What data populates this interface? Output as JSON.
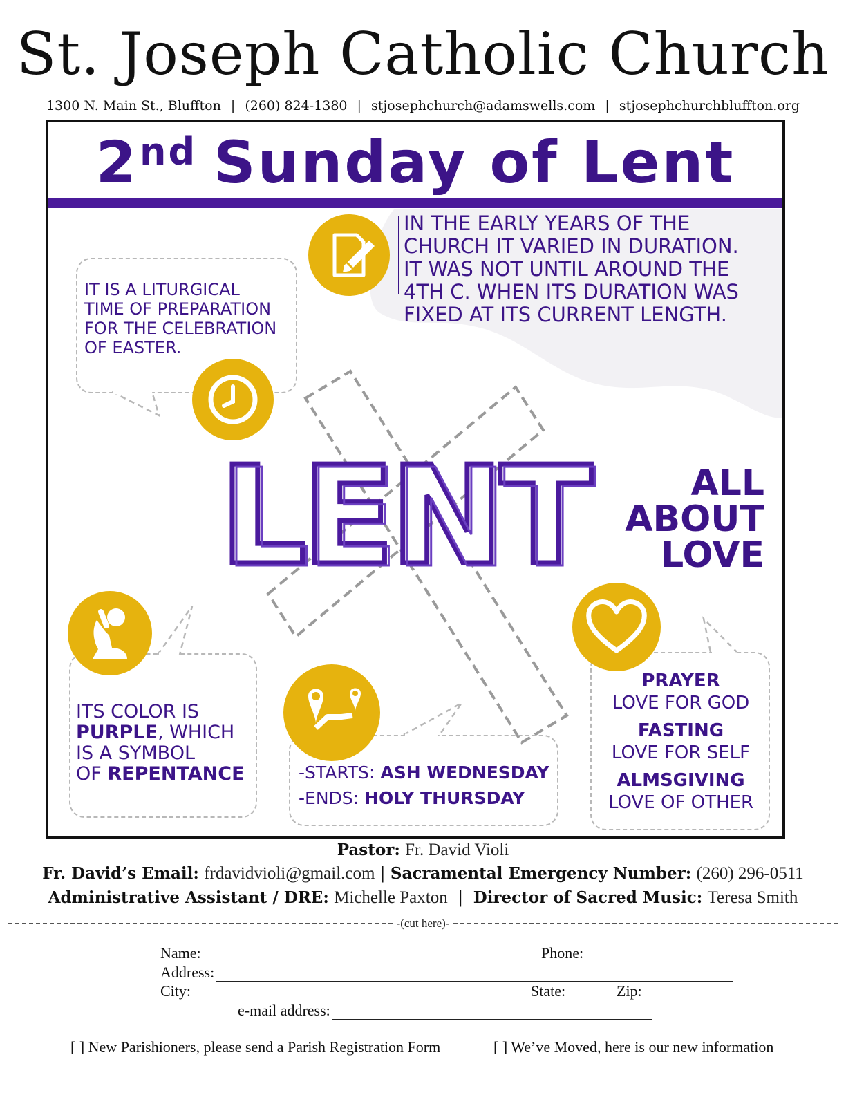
{
  "header": {
    "church_name": "St. Joseph Catholic Church",
    "address": "1300 N. Main St., Bluffton",
    "phone": "(260) 824-1380",
    "email": "stjosephchurch@adamswells.com",
    "website": "stjosephchurchbluffton.org",
    "separator": "|"
  },
  "bulletin": {
    "ordinal_number": "2",
    "ordinal_suffix": "nd",
    "title_rest": "Sunday of Lent"
  },
  "infographic": {
    "lent_word": "LENT",
    "tagline_lines": [
      "ALL",
      "ABOUT",
      "LOVE"
    ],
    "history_lines": [
      "IN THE EARLY YEARS OF THE",
      "CHURCH IT VARIED IN DURATION.",
      "IT WAS NOT UNTIL AROUND THE",
      "4TH C. WHEN ITS DURATION WAS",
      "FIXED AT ITS CURRENT LENGTH."
    ],
    "definition_lines": [
      "IT IS A LITURGICAL",
      "TIME OF PREPARATION",
      "FOR THE CELEBRATION",
      "OF EASTER."
    ],
    "color": {
      "l1": "ITS COLOR IS",
      "l2_bold": "PURPLE",
      "l2_rest": ", WHICH",
      "l3": "IS A SYMBOL",
      "l4_pre": "OF ",
      "l4_bold": "REPENTANCE"
    },
    "dates": {
      "starts_label": "-STARTS: ",
      "starts_value": "ASH WEDNESDAY",
      "ends_label": "-ENDS: ",
      "ends_value": "HOLY THURSDAY"
    },
    "pillars": [
      {
        "name": "PRAYER",
        "meaning": "LOVE FOR GOD"
      },
      {
        "name": "FASTING",
        "meaning": "LOVE FOR SELF"
      },
      {
        "name": "ALMSGIVING",
        "meaning": "LOVE OF OTHER"
      }
    ],
    "icons": [
      "document-pencil-icon",
      "clock-icon",
      "kneeling-prayer-icon",
      "map-route-icon",
      "heart-icon"
    ],
    "colors": {
      "purple": "#3c1488",
      "gold": "#e6b30e",
      "grey": "#b8b8b8"
    }
  },
  "staff": {
    "pastor_label": "Pastor:",
    "pastor_name": "Fr. David Violi",
    "email_label": "Fr. David’s Email:",
    "email_value": "frdavidvioli@gmail.com",
    "emergency_label": "Sacramental Emergency Number:",
    "emergency_value": "(260) 296-0511",
    "admin_label": "Administrative Assistant / DRE:",
    "admin_name": "Michelle Paxton",
    "music_label": "Director of Sacred Music:",
    "music_name": "Teresa Smith"
  },
  "form": {
    "cut_label": "-(cut here)-",
    "name_label": "Name:",
    "phone_label": "Phone:",
    "address_label": "Address:",
    "city_label": "City:",
    "state_label": "State:",
    "zip_label": "Zip:",
    "email_label": "e-mail address:",
    "new_parishioner_option": "[ ] New Parishioners, please send a Parish Registration Form",
    "moved_option": "[ ] We’ve Moved, here is our new information"
  }
}
